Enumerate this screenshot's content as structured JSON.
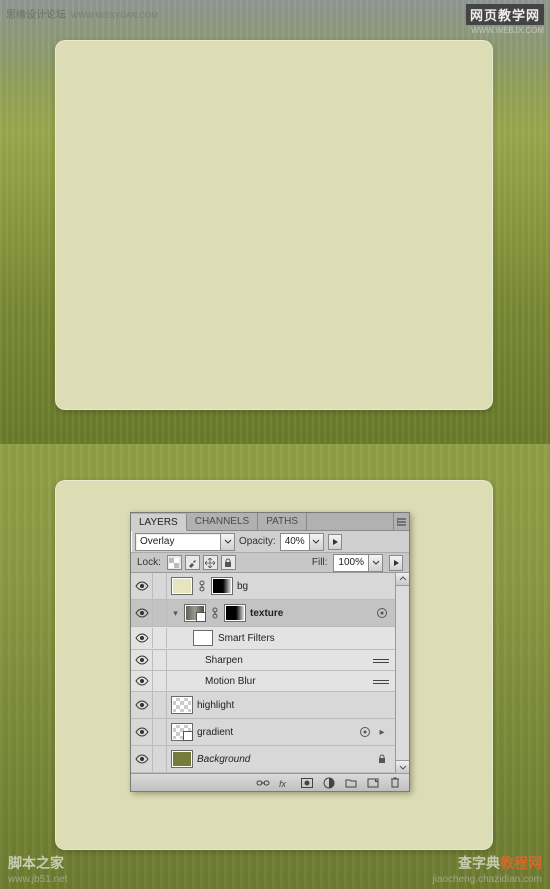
{
  "watermarks": {
    "top_left_main": "思缘设计论坛",
    "top_left_sub": "WWW.MISSYUAN.COM",
    "top_right_main": "网页教学网",
    "top_right_sub": "WWW.WEBJX.COM",
    "bottom_left_main": "脚本之家",
    "bottom_left_sub": "www.jb51.net",
    "bottom_right_main_a": "查字典",
    "bottom_right_main_b": "教程网",
    "bottom_right_sub": "jiaocheng.chazidian.com"
  },
  "panel": {
    "tabs": [
      "LAYERS",
      "CHANNELS",
      "PATHS"
    ],
    "active_tab": 0,
    "blend_label": "Overlay",
    "opacity_label": "Opacity:",
    "opacity_value": "40%",
    "lock_label": "Lock:",
    "fill_label": "Fill:",
    "fill_value": "100%"
  },
  "layers": {
    "bg": "bg",
    "texture": "texture",
    "smart_filters": "Smart Filters",
    "sharpen": "Sharpen",
    "motion_blur": "Motion Blur",
    "highlight": "highlight",
    "gradient": "gradient",
    "background": "Background"
  }
}
